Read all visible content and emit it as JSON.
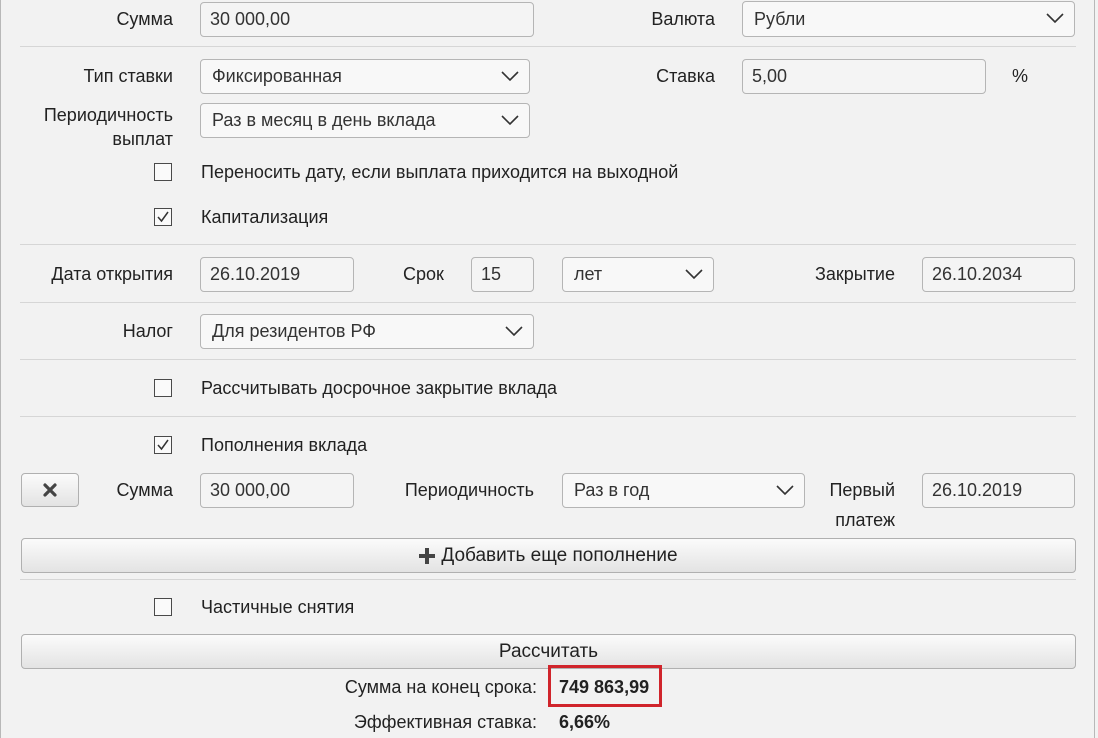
{
  "deposit": {
    "amount_label": "Сумма",
    "amount_value": "30 000,00",
    "currency_label": "Валюта",
    "currency_value": "Рубли",
    "rate_type_label": "Тип ставки",
    "rate_type_value": "Фиксированная",
    "rate_label": "Ставка",
    "rate_value": "5,00",
    "rate_unit": "%",
    "payout_label_line1": "Периодичность",
    "payout_label_line2": "выплат",
    "payout_value": "Раз в месяц в день вклада",
    "move_date_label": "Переносить дату, если выплата приходится на выходной",
    "move_date_checked": false,
    "capitalization_label": "Капитализация",
    "capitalization_checked": true
  },
  "term": {
    "open_date_label": "Дата открытия",
    "open_date_value": "26.10.2019",
    "term_label": "Срок",
    "term_value": "15",
    "term_unit_value": "лет",
    "close_label": "Закрытие",
    "close_value": "26.10.2034"
  },
  "tax": {
    "label": "Налог",
    "value": "Для резидентов РФ"
  },
  "early_close": {
    "label": "Рассчитывать досрочное закрытие вклада",
    "checked": false
  },
  "topups": {
    "label": "Пополнения вклада",
    "checked": true,
    "amount_label": "Сумма",
    "amount_value": "30 000,00",
    "period_label": "Периодичность",
    "period_value": "Раз в год",
    "first_label_line1": "Первый",
    "first_label_line2": "платеж",
    "first_value": "26.10.2019",
    "add_button": "Добавить еще пополнение"
  },
  "withdrawals": {
    "label": "Частичные снятия",
    "checked": false
  },
  "calculate_button": "Рассчитать",
  "result": {
    "total_label": "Сумма на конец срока:",
    "total_value": "749 863,99",
    "effective_label": "Эффективная ставка:",
    "effective_value": "6,66%"
  },
  "colors": {
    "highlight": "#d0242b",
    "background": "#f2f2f2"
  }
}
